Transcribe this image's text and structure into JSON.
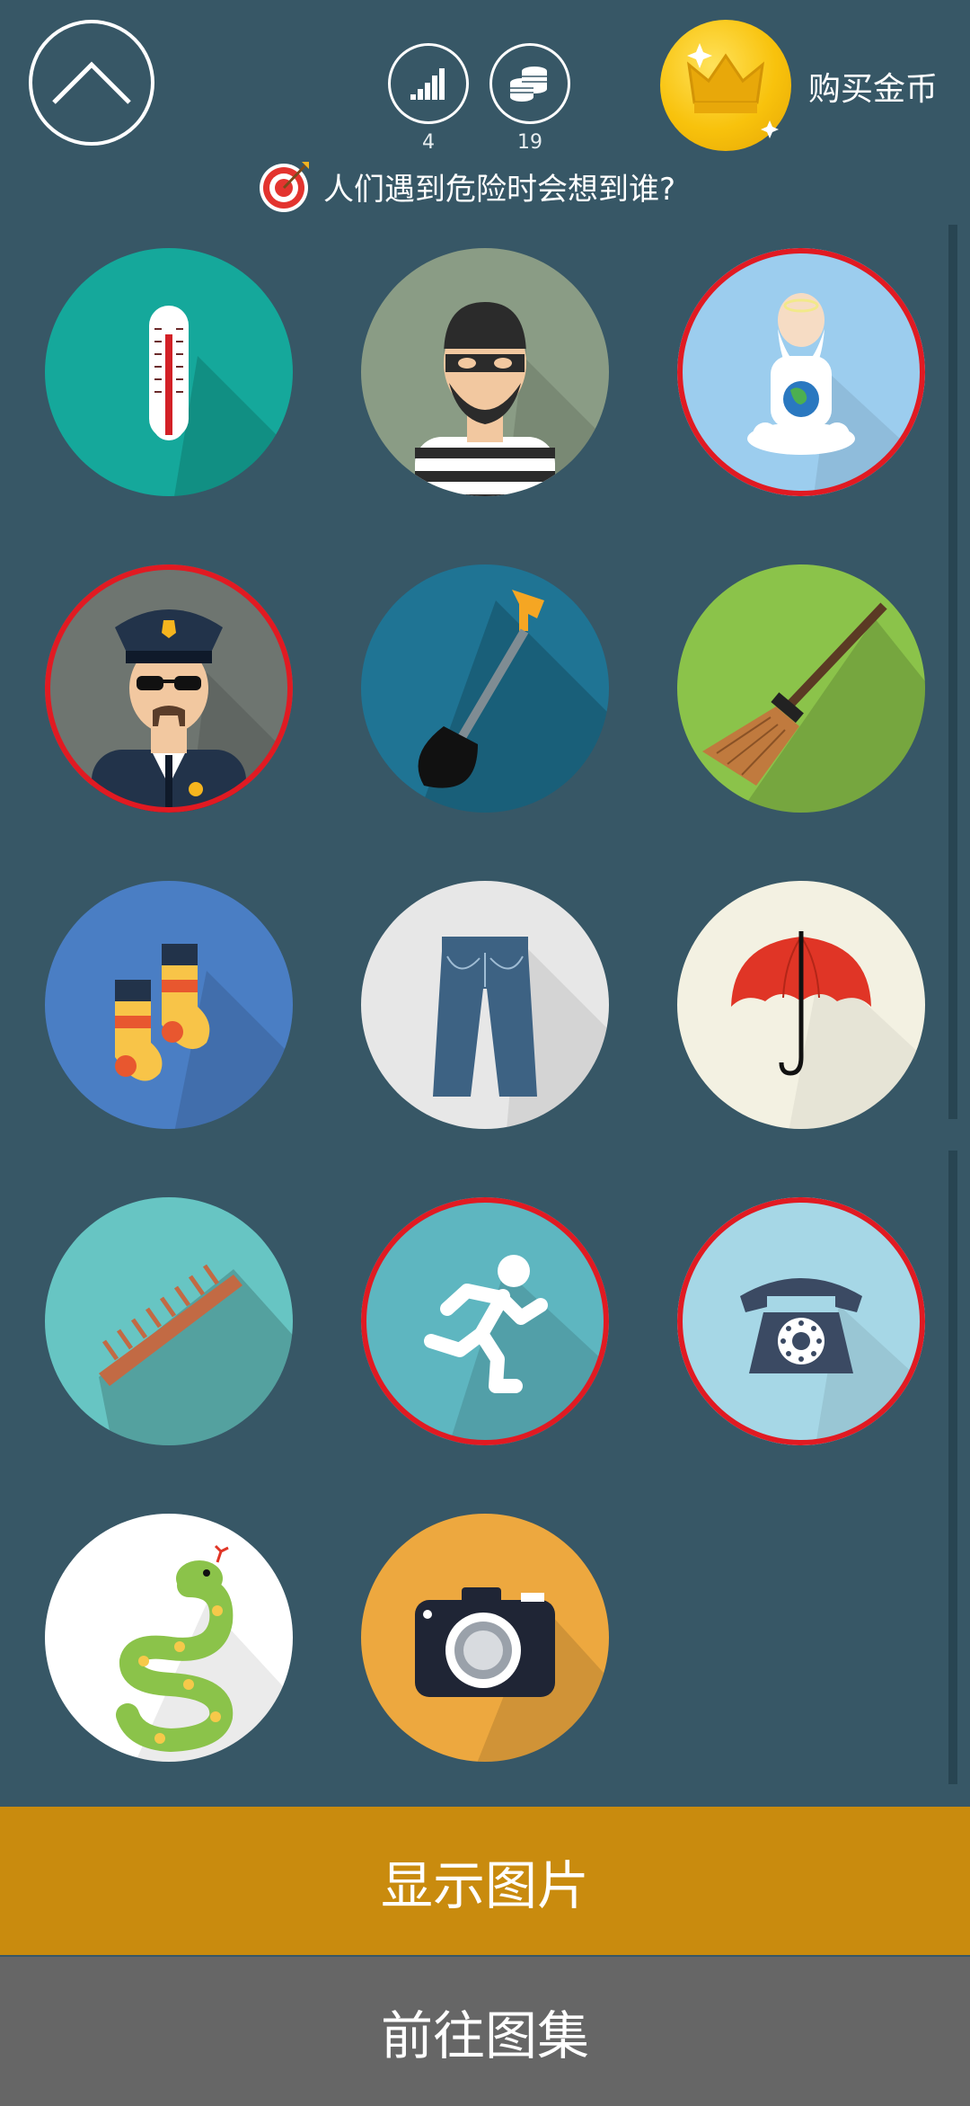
{
  "header": {
    "back_icon": "chevron-up-icon",
    "level_value": "4",
    "coins_value": "19",
    "buy_label": "购买金币",
    "question": "人们遇到危险时会想到谁?"
  },
  "grid": {
    "items": [
      {
        "name": "thermometer",
        "bg": "#15a89b",
        "selected": false
      },
      {
        "name": "thief",
        "bg": "#8a9c85",
        "selected": false
      },
      {
        "name": "god",
        "bg": "#9ccdee",
        "selected": true
      },
      {
        "name": "policeman",
        "bg": "#6e7570",
        "selected": true
      },
      {
        "name": "shovel",
        "bg": "#1f7494",
        "selected": false
      },
      {
        "name": "broom",
        "bg": "#8bc34a",
        "selected": false
      },
      {
        "name": "socks",
        "bg": "#4a7ec4",
        "selected": false
      },
      {
        "name": "jeans",
        "bg": "#e7e7e7",
        "selected": false
      },
      {
        "name": "umbrella",
        "bg": "#f3f1e2",
        "selected": false
      },
      {
        "name": "comb",
        "bg": "#67c5c3",
        "selected": false
      },
      {
        "name": "running-man",
        "bg": "#5eb6c0",
        "selected": true
      },
      {
        "name": "telephone",
        "bg": "#a6d7e6",
        "selected": true
      },
      {
        "name": "snake",
        "bg": "#ffffff",
        "selected": false
      },
      {
        "name": "camera",
        "bg": "#eda83f",
        "selected": false
      }
    ]
  },
  "buttons": {
    "show_label": "显示图片",
    "gallery_label": "前往图集"
  }
}
